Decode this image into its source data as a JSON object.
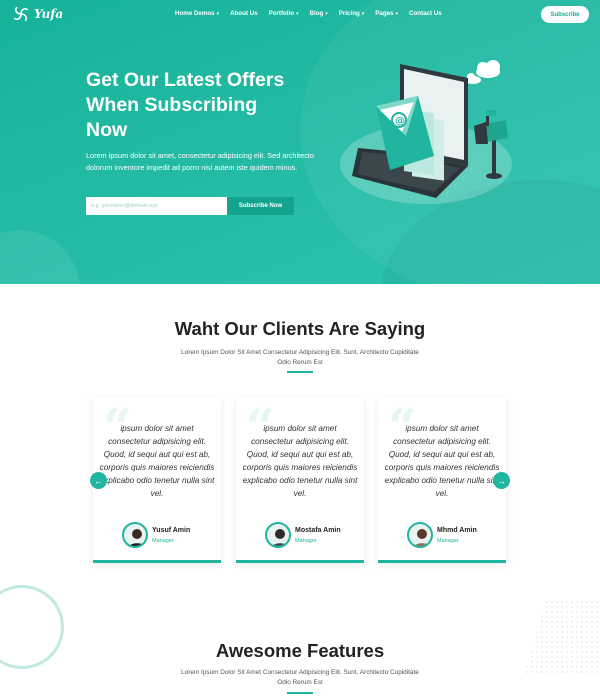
{
  "brand": {
    "name": "Yufa"
  },
  "nav": {
    "items": [
      {
        "label": "Home Demos",
        "has_dropdown": true
      },
      {
        "label": "About Us",
        "has_dropdown": false
      },
      {
        "label": "Portfolio",
        "has_dropdown": true
      },
      {
        "label": "Blog",
        "has_dropdown": true
      },
      {
        "label": "Pricing",
        "has_dropdown": true
      },
      {
        "label": "Pages",
        "has_dropdown": true
      },
      {
        "label": "Contact Us",
        "has_dropdown": false
      }
    ],
    "subscribe_label": "Subscribe",
    "dropdown_caret": "▾"
  },
  "hero": {
    "title": "Get Our Latest Offers When Subscribing Now",
    "text": "Lorem ipsum dolor sit amet, consectetur adipisicing elit. Sed architecto dolorum inventore impedit ad porro nisi autem iste quidem minus.",
    "email_placeholder": "e.g. youname@domain.xyz",
    "button_label": "Subscribe Now"
  },
  "testimonials": {
    "title": "Waht Our Clients Are Saying",
    "subtitle": "Lorem Ipsum Dolor Sit Amet Consectetur Adipisicing Elit. Sunt, Architecto Cupiditate Odio Rerum Est",
    "quote_mark": "“",
    "items": [
      {
        "text": "ipsum dolor sit amet consectetur adipisicing elit. Quod, id sequi aut qui est ab, corporis quis maiores reiciendis explicabo odio tenetur nulla sint vel.",
        "name": "Yusuf Amin",
        "role": "Manager"
      },
      {
        "text": "ipsum dolor sit amet consectetur adipisicing elit. Quod, id sequi aut qui est ab, corporis quis maiores reiciendis explicabo odio tenetur nulla sint vel.",
        "name": "Mostafa Amin",
        "role": "Manager"
      },
      {
        "text": "ipsum dolor sit amet consectetur adipisicing elit. Quod, id sequi aut qui est ab, corporis quis maiores reiciendis explicabo odio tenetur nulla sint vel.",
        "name": "Mhmd Amin",
        "role": "Manager"
      }
    ],
    "prev_icon": "←",
    "next_icon": "→"
  },
  "features": {
    "title": "Awesome Features",
    "subtitle": "Lorem Ipsum Dolor Sit Amet Consectetur Adipisicing Elit. Sunt, Architecto Cupiditate Odio Rerum Est"
  },
  "colors": {
    "accent": "#1fb59e",
    "hero_gradient_start": "#17b29a",
    "hero_gradient_end": "#2cc3b0",
    "button_dark": "#13a48d"
  },
  "icons": [
    "logo-swirl-icon",
    "chevron-down-icon",
    "envelope-icon",
    "laptop-icon",
    "cloud-icon",
    "mailbox-icon",
    "quote-icon",
    "arrow-left-icon",
    "arrow-right-icon"
  ]
}
